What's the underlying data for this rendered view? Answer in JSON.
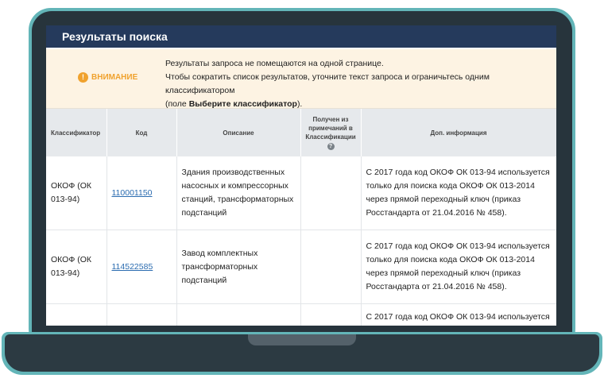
{
  "window": {
    "title": "Результаты поиска"
  },
  "notice": {
    "label": "ВНИМАНИЕ",
    "line1": "Результаты запроса не помещаются на одной странице.",
    "line2": "Чтобы сократить список результатов, уточните текст запроса и ограничьтесь одним классификатором",
    "line3_prefix": "(поле ",
    "line3_bold": "Выберите классификатор",
    "line3_suffix": ")."
  },
  "table": {
    "headers": {
      "classifier": "Классификатор",
      "code": "Код",
      "description": "Описание",
      "from_notes": "Получен из примечаний в Классификации",
      "extra": "Доп. информация"
    },
    "rows": [
      {
        "classifier": "ОКОФ (ОК 013-94)",
        "code": "110001150",
        "description": "Здания производственных насосных и компрессорных станций, трансформаторных подстанций",
        "from_notes": "",
        "extra": "С 2017 года код ОКОФ ОК 013-94 используется только для поиска кода ОКОФ ОК 013-2014 через прямой переходный ключ (приказ Росстандарта от 21.04.2016 № 458)."
      },
      {
        "classifier": "ОКОФ (ОК 013-94)",
        "code": "114522585",
        "description": "Завод комплектных трансформаторных подстанций",
        "from_notes": "",
        "extra": "С 2017 года код ОКОФ ОК 013-94 используется только для поиска кода ОКОФ ОК 013-2014 через прямой переходный ключ (приказ Росстандарта от 21.04.2016 № 458)."
      },
      {
        "classifier": "",
        "code": "",
        "description": "",
        "from_notes": "",
        "extra": "С 2017 года код ОКОФ ОК 013-94 используется"
      }
    ]
  },
  "icons": {
    "notice": "info-icon",
    "header_help": "help-icon"
  },
  "colors": {
    "titlebar": "#253a5c",
    "notice_bg": "#fdf3e3",
    "notice_accent": "#f0a22e",
    "header_bg": "#e6e9ec",
    "link": "#2b6cb0",
    "frame": "#27343c",
    "frame_glow": "#63b5b8"
  }
}
